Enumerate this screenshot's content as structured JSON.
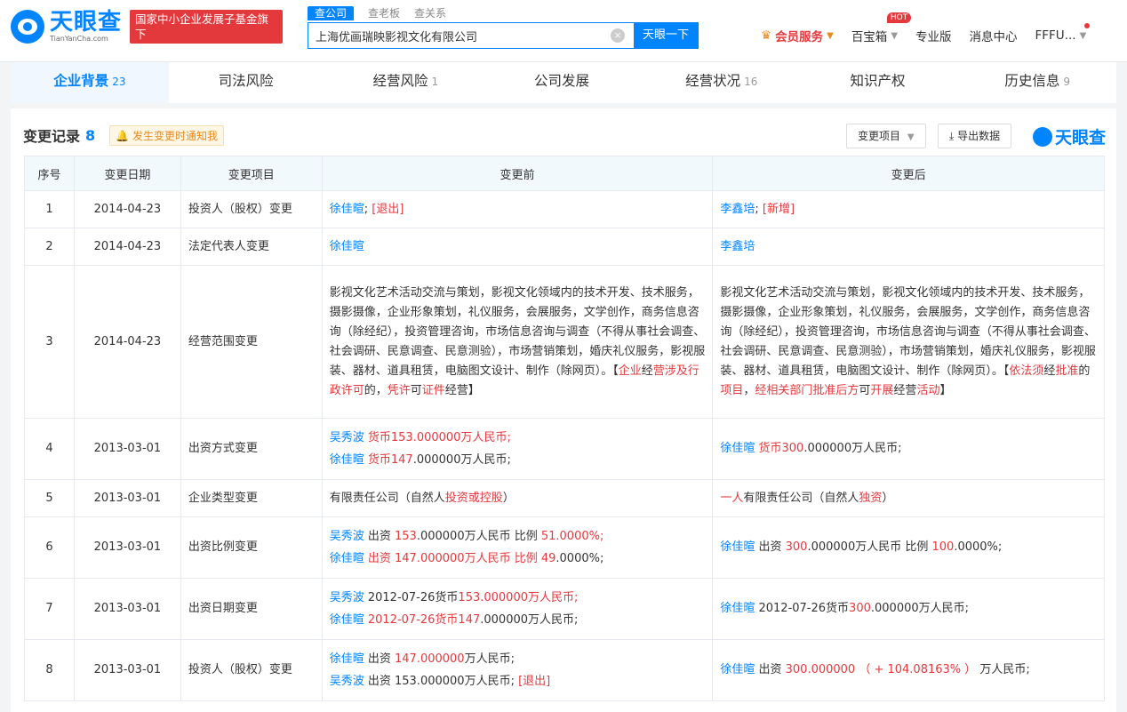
{
  "header": {
    "logo_cn": "天眼查",
    "logo_en": "TianYanCha.com",
    "banner_line1": "国家中小企业发展子基金旗下",
    "banner_line2": "官方备案企业征信机构",
    "search_tabs": [
      "查公司",
      "查老板",
      "查关系"
    ],
    "search_value": "上海优画瑞映影视文化有限公司",
    "search_button": "天眼一下",
    "clear_symbol": "×",
    "vip_label": "会员服务",
    "baibao_label": "百宝箱",
    "hot_badge": "HOT",
    "pro_label": "专业版",
    "msg_label": "消息中心",
    "user_label": "FFFU..."
  },
  "tabs": [
    {
      "label": "企业背景",
      "count": "23"
    },
    {
      "label": "司法风险",
      "count": ""
    },
    {
      "label": "经营风险",
      "count": "1"
    },
    {
      "label": "公司发展",
      "count": ""
    },
    {
      "label": "经营状况",
      "count": "16"
    },
    {
      "label": "知识产权",
      "count": ""
    },
    {
      "label": "历史信息",
      "count": "9"
    }
  ],
  "panel": {
    "title": "变更记录",
    "count": "8",
    "notify": "发生变更时通知我",
    "filter_btn": "变更项目",
    "export_btn": "导出数据",
    "brand": "天眼查"
  },
  "table": {
    "headers": [
      "序号",
      "变更日期",
      "变更项目",
      "变更前",
      "变更后"
    ],
    "rows": [
      {
        "no": "1",
        "date": "2014-04-23",
        "item": "投资人（股权）变更",
        "before": [
          [
            [
              "link",
              "徐佳暄"
            ],
            [
              "",
              "; "
            ],
            [
              "red",
              "[退出]"
            ]
          ]
        ],
        "after": [
          [
            [
              "link",
              "李鑫培"
            ],
            [
              "",
              "; "
            ],
            [
              "red",
              "[新增]"
            ]
          ]
        ]
      },
      {
        "no": "2",
        "date": "2014-04-23",
        "item": "法定代表人变更",
        "before": [
          [
            [
              "link",
              "徐佳暄"
            ]
          ]
        ],
        "after": [
          [
            [
              "link",
              "李鑫培"
            ]
          ]
        ]
      },
      {
        "no": "3",
        "date": "2014-04-23",
        "item": "经营范围变更",
        "before": [
          [
            [
              "",
              "影视文化艺术活动交流与策划，影视文化领域内的技术开发、技术服务，摄影摄像，企业形象策划，礼仪服务，会展服务，文学创作，商务信息咨询（除经纪），投资管理咨询，市场信息咨询与调查（不得从事社会调查、社会调研、民意调查、民意测验），市场营销策划，婚庆礼仪服务，影视服装、器材、道具租赁，电脑图文设计、制作（除网页）。【"
            ],
            [
              "red",
              "企业"
            ],
            [
              "",
              "经"
            ],
            [
              "red",
              "营涉及行政许可"
            ],
            [
              "",
              "的，"
            ],
            [
              "red",
              "凭许"
            ],
            [
              "",
              "可"
            ],
            [
              "red",
              "证件"
            ],
            [
              "",
              "经营】"
            ]
          ]
        ],
        "after": [
          [
            [
              "",
              "影视文化艺术活动交流与策划，影视文化领域内的技术开发、技术服务，摄影摄像，企业形象策划，礼仪服务，会展服务，文学创作，商务信息咨询（除经纪），投资管理咨询，市场信息咨询与调查（不得从事社会调查、社会调研、民意调查、民意测验），市场营销策划，婚庆礼仪服务，影视服装、器材、道具租赁，电脑图文设计、制作（除网页）。【"
            ],
            [
              "red",
              "依法须"
            ],
            [
              "",
              "经"
            ],
            [
              "red",
              "批准"
            ],
            [
              "",
              "的"
            ],
            [
              "red",
              "项目"
            ],
            [
              "",
              "，"
            ],
            [
              "red",
              "经相关部门批准后方"
            ],
            [
              "",
              "可"
            ],
            [
              "red",
              "开展"
            ],
            [
              "",
              "经营"
            ],
            [
              "red",
              "活动"
            ],
            [
              "",
              "】"
            ]
          ]
        ]
      },
      {
        "no": "4",
        "date": "2013-03-01",
        "item": "出资方式变更",
        "before": [
          [
            [
              "link",
              "吴秀波"
            ],
            [
              "",
              " "
            ],
            [
              "red",
              "货币153.000000万人民币;"
            ]
          ],
          [
            [
              "link",
              "徐佳暄"
            ],
            [
              "",
              " "
            ],
            [
              "red",
              "货币147"
            ],
            [
              "",
              ".000000万人民币;"
            ]
          ]
        ],
        "after": [
          [
            [
              "link",
              "徐佳暄"
            ],
            [
              "",
              " "
            ],
            [
              "red",
              "货币300"
            ],
            [
              "",
              ".000000万人民币;"
            ]
          ]
        ]
      },
      {
        "no": "5",
        "date": "2013-03-01",
        "item": "企业类型变更",
        "before": [
          [
            [
              "",
              "有限责任公司（自然人"
            ],
            [
              "red",
              "投资或控股"
            ],
            [
              "",
              "）"
            ]
          ]
        ],
        "after": [
          [
            [
              "red",
              "一人"
            ],
            [
              "",
              "有限责任公司（自然人"
            ],
            [
              "red",
              "独资"
            ],
            [
              "",
              "）"
            ]
          ]
        ]
      },
      {
        "no": "6",
        "date": "2013-03-01",
        "item": "出资比例变更",
        "before": [
          [
            [
              "link",
              "吴秀波"
            ],
            [
              "",
              " 出资 "
            ],
            [
              "red",
              "153"
            ],
            [
              "",
              ".000000万人民币 比例 "
            ],
            [
              "red",
              "51.0000%;"
            ]
          ],
          [
            [
              "link",
              "徐佳暄"
            ],
            [
              "",
              " "
            ],
            [
              "red",
              "出资 147.000000万人民币 比例 49"
            ],
            [
              "",
              ".0000%;"
            ]
          ]
        ],
        "after": [
          [
            [
              "link",
              "徐佳暄"
            ],
            [
              "",
              " 出资 "
            ],
            [
              "red",
              "300"
            ],
            [
              "",
              ".000000万人民币 比例 "
            ],
            [
              "red",
              "100"
            ],
            [
              "",
              ".0000%;"
            ]
          ]
        ]
      },
      {
        "no": "7",
        "date": "2013-03-01",
        "item": "出资日期变更",
        "before": [
          [
            [
              "link",
              "吴秀波"
            ],
            [
              "",
              " 2012-07-26货币"
            ],
            [
              "red",
              "153.000000万人民币;"
            ]
          ],
          [
            [
              "link",
              "徐佳暄"
            ],
            [
              "",
              " "
            ],
            [
              "red",
              "2012-07-26货币147"
            ],
            [
              "",
              ".000000万人民币;"
            ]
          ]
        ],
        "after": [
          [
            [
              "link",
              "徐佳暄"
            ],
            [
              "",
              " 2012-07-26货币"
            ],
            [
              "red",
              "300"
            ],
            [
              "",
              ".000000万人民币;"
            ]
          ]
        ]
      },
      {
        "no": "8",
        "date": "2013-03-01",
        "item": "投资人（股权）变更",
        "before": [
          [
            [
              "link",
              "徐佳暄"
            ],
            [
              "",
              " 出资 "
            ],
            [
              "red",
              "147.000000"
            ],
            [
              "",
              "万人民币;"
            ]
          ],
          [
            [
              "link",
              "吴秀波"
            ],
            [
              "",
              " 出资 153.000000万人民币; "
            ],
            [
              "red",
              "[退出]"
            ]
          ]
        ],
        "after": [
          [
            [
              "link",
              "徐佳暄"
            ],
            [
              "",
              " 出资 "
            ],
            [
              "red",
              "300.000000 （ + 104.08163% ）"
            ],
            [
              "",
              " 万人民币;"
            ]
          ]
        ]
      }
    ]
  }
}
